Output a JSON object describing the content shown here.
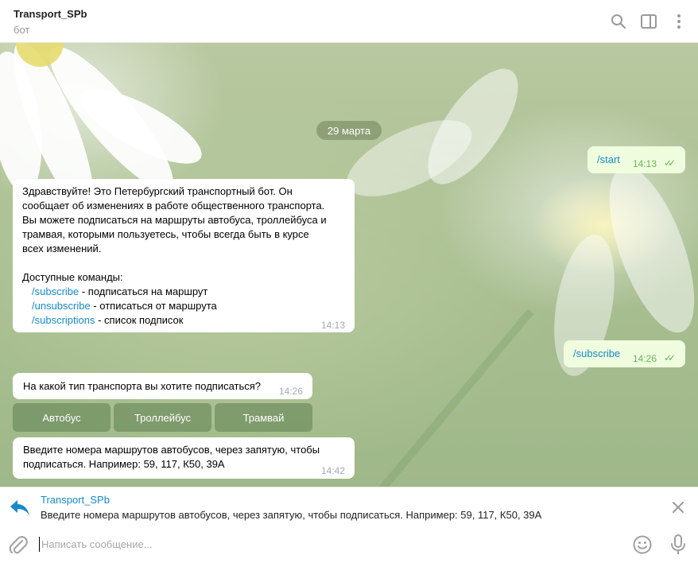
{
  "header": {
    "title": "Transport_SPb",
    "subtitle": "бот",
    "icons": [
      "search-icon",
      "sidebar-toggle-icon",
      "more-vertical-icon"
    ]
  },
  "chat": {
    "date": "29 марта",
    "messages": [
      {
        "dir": "out",
        "text": "/start",
        "time": "14:13",
        "ticks": "✓✓"
      },
      {
        "dir": "in",
        "lines": [
          "Здравствуйте! Это Петербургский транспортный бот. Он",
          "сообщает об изменениях в работе общественного транспорта.",
          "Вы можете подписаться на маршруты автобуса, троллейбуса и",
          "трамвая, которыми пользуетесь, чтобы всегда быть в курсе",
          "всех изменений."
        ],
        "commands_title": "Доступные команды:",
        "commands": [
          {
            "cmd": "/subscribe",
            "desc": " - подписаться на маршрут"
          },
          {
            "cmd": "/unsubscribe",
            "desc": " - отписаться от маршрута"
          },
          {
            "cmd": "/subscriptions",
            "desc": " - список подписок"
          }
        ],
        "time": "14:13"
      },
      {
        "dir": "out",
        "text": "/subscribe",
        "time": "14:26",
        "ticks": "✓✓"
      },
      {
        "dir": "in",
        "text": "На какой тип транспорта вы хотите подписаться?",
        "time": "14:26"
      },
      {
        "dir": "in",
        "lines": [
          "Введите номера маршрутов автобусов, через запятую, чтобы",
          "подписаться. Например: 59, 117, К50, 39А"
        ],
        "time": "14:42"
      }
    ],
    "keyboard": [
      "Автобус",
      "Троллейбус",
      "Трамвай"
    ]
  },
  "reply": {
    "name": "Transport_SPb",
    "text": "Введите номера маршрутов автобусов, через запятую, чтобы подписаться. Например: 59, 117, К50, 39А"
  },
  "compose": {
    "placeholder": "Написать сообщение...",
    "value": ""
  },
  "colors": {
    "accent": "#168acd",
    "outgoing_bubble": "#effdde",
    "read_ticks": "#5fb554"
  }
}
